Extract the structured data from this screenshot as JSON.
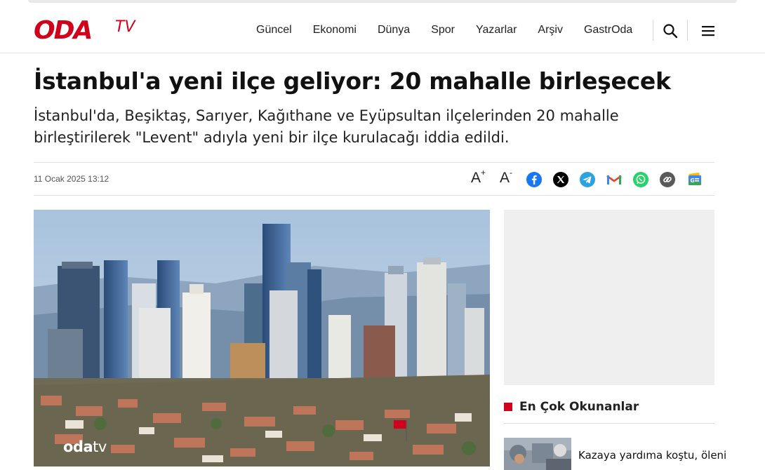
{
  "brand": {
    "logo_text_bold": "ODA",
    "logo_text_thin": "TV",
    "brand_color": "#d0021b"
  },
  "nav": {
    "items": [
      {
        "label": "Güncel"
      },
      {
        "label": "Ekonomi"
      },
      {
        "label": "Dünya"
      },
      {
        "label": "Spor"
      },
      {
        "label": "Yazarlar"
      },
      {
        "label": "Arşiv"
      },
      {
        "label": "GastrOda"
      }
    ],
    "search_icon": "search-icon",
    "menu_icon": "hamburger-menu-icon"
  },
  "article": {
    "title": "İstanbul'a yeni ilçe geliyor: 20 mahalle birleşecek",
    "summary": "İstanbul'da, Beşiktaş, Sarıyer, Kağıthane ve Eyüpsultan ilçelerinden 20 mahalle birleştirilerek \"Levent\" adıyla yeni bir ilçe kurulacağı iddia edildi.",
    "date": "11 Ocak 2025 13:12",
    "font_increase": "A",
    "font_increase_sup": "+",
    "font_decrease": "A",
    "font_decrease_sup": "-",
    "share_icons": [
      "facebook-icon",
      "x-icon",
      "telegram-icon",
      "gmail-icon",
      "whatsapp-icon",
      "link-icon",
      "google-news-icon"
    ],
    "image_watermark_bold": "oda",
    "image_watermark_thin": "tv"
  },
  "sidebar": {
    "section_title": "En Çok Okunanlar",
    "popular": [
      {
        "title": "Kazaya yardıma koştu, öleni"
      }
    ]
  }
}
